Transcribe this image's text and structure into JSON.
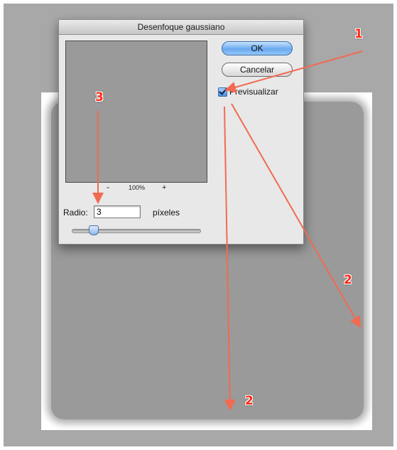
{
  "dialog": {
    "title": "Desenfoque gaussiano",
    "ok_label": "OK",
    "cancel_label": "Cancelar",
    "preview_checkbox": {
      "label": "Previsualizar",
      "checked": true
    },
    "zoom": {
      "minus": "-",
      "percent": "100%",
      "plus": "+"
    },
    "radius": {
      "label": "Radio:",
      "value": "3",
      "unit": "píxeles"
    },
    "slider_level_fraction": 0.17
  },
  "annotations": {
    "marker_1": "1",
    "marker_2a": "2",
    "marker_2b": "2",
    "marker_3": "3",
    "arrow_color": "#f26a52"
  },
  "colors": {
    "workspace": "#a8a8a8",
    "blurred_canvas": "#9a9a9a",
    "ok_button_accent": "#6aa9ee"
  }
}
